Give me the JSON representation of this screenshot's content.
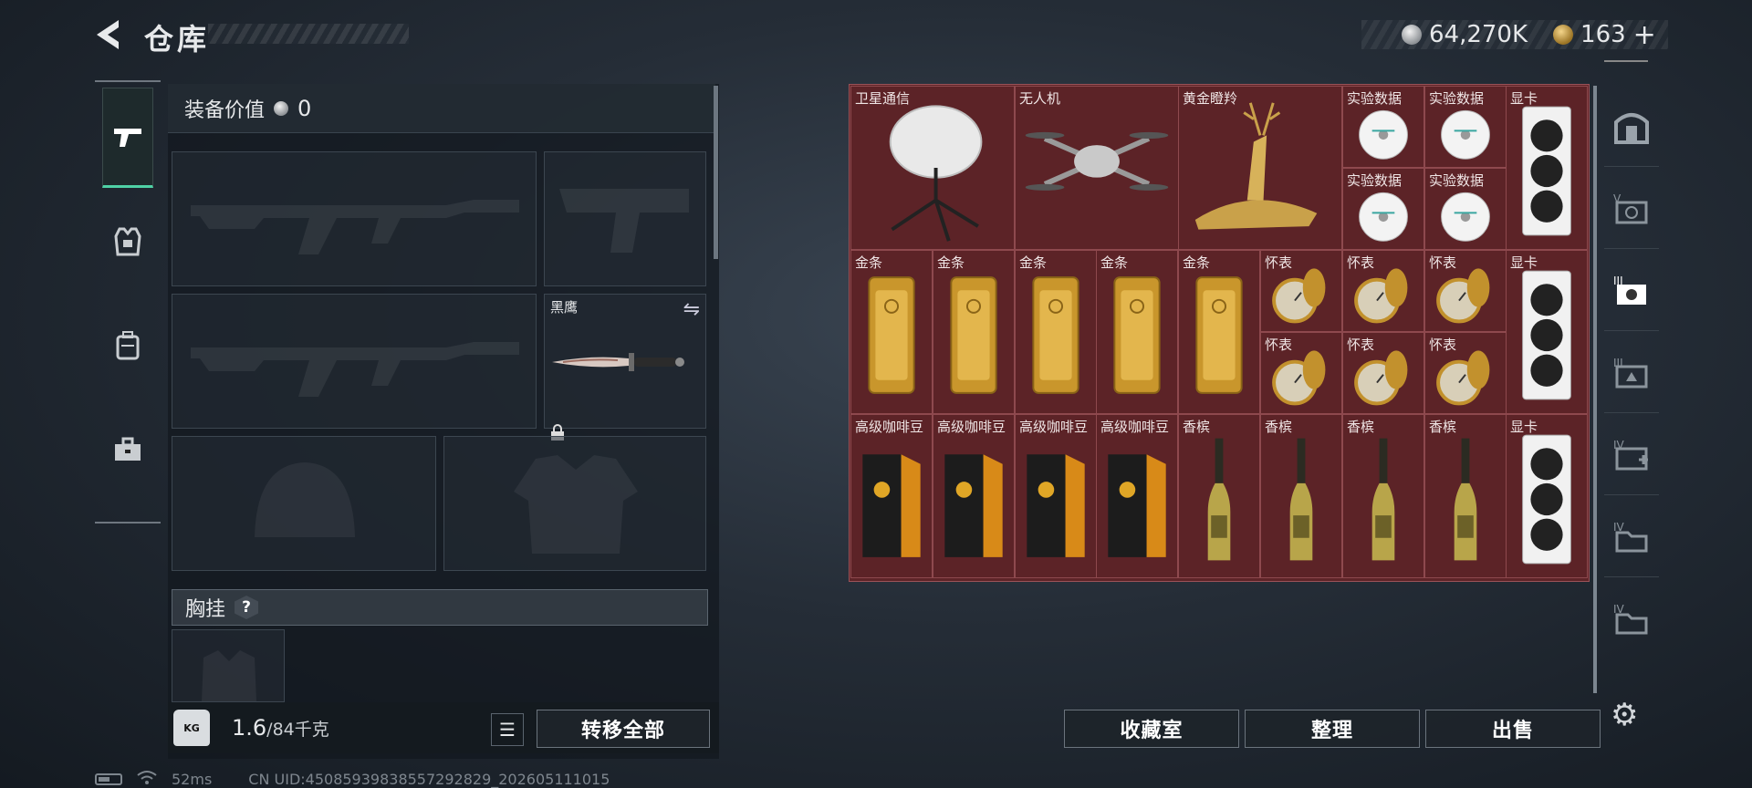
{
  "header": {
    "title": "仓库"
  },
  "currency": {
    "silver": "64,270K",
    "gold": "163",
    "plus": "+"
  },
  "equipment": {
    "value_label": "装备价值",
    "value": "0",
    "knife_label": "黑鹰",
    "chest_label": "胸挂",
    "chest_help": "?"
  },
  "weight": {
    "current": "1.6",
    "max": "/84千克",
    "kg_badge": "KG"
  },
  "buttons": {
    "transfer_all": "转移全部",
    "collection": "收藏室",
    "organize": "整理",
    "sell": "出售"
  },
  "status_bar": {
    "ping": "52ms",
    "uid": "CN UID:4508593983855729​2829_202605111015"
  },
  "right_rail": {
    "tab_labels": [
      "V",
      "III",
      "III",
      "IV",
      "IV",
      "IV"
    ]
  },
  "storage_items": [
    {
      "label": "卫星通信",
      "type": "satellite"
    },
    {
      "label": "无人机",
      "type": "drone"
    },
    {
      "label": "黄金瞪羚",
      "type": "gazelle"
    },
    {
      "label": "实验数据",
      "type": "disc"
    },
    {
      "label": "实验数据",
      "type": "disc"
    },
    {
      "label": "显卡",
      "type": "gpu"
    },
    {
      "label": "实验数据",
      "type": "disc"
    },
    {
      "label": "实验数据",
      "type": "disc"
    },
    {
      "label": "金条",
      "type": "goldbar"
    },
    {
      "label": "金条",
      "type": "goldbar"
    },
    {
      "label": "金条",
      "type": "goldbar"
    },
    {
      "label": "金条",
      "type": "goldbar"
    },
    {
      "label": "金条",
      "type": "goldbar"
    },
    {
      "label": "怀表",
      "type": "watch"
    },
    {
      "label": "怀表",
      "type": "watch"
    },
    {
      "label": "怀表",
      "type": "watch"
    },
    {
      "label": "显卡",
      "type": "gpu"
    },
    {
      "label": "怀表",
      "type": "watch"
    },
    {
      "label": "怀表",
      "type": "watch"
    },
    {
      "label": "怀表",
      "type": "watch"
    },
    {
      "label": "高级咖啡豆",
      "type": "coffee"
    },
    {
      "label": "高级咖啡豆",
      "type": "coffee"
    },
    {
      "label": "高级咖啡豆",
      "type": "coffee"
    },
    {
      "label": "高级咖啡豆",
      "type": "coffee"
    },
    {
      "label": "香槟",
      "type": "champagne"
    },
    {
      "label": "香槟",
      "type": "champagne"
    },
    {
      "label": "香槟",
      "type": "champagne"
    },
    {
      "label": "香槟",
      "type": "champagne"
    },
    {
      "label": "显卡",
      "type": "gpu"
    }
  ]
}
